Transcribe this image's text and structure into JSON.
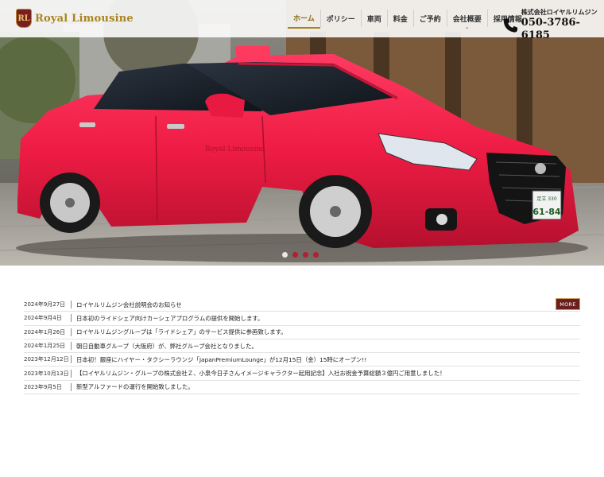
{
  "brand": {
    "logo_mark": "RL",
    "name": "Royal Limousine"
  },
  "nav": {
    "items": [
      {
        "label": "ホーム",
        "active": true
      },
      {
        "label": "ポリシー"
      },
      {
        "label": "車両"
      },
      {
        "label": "料金"
      },
      {
        "label": "ご予約"
      },
      {
        "label": "会社概要",
        "has_dropdown": true
      },
      {
        "label": "採用情報"
      }
    ]
  },
  "contact": {
    "company": "株式会社ロイヤルリムジン",
    "phone": "050-3786-6185"
  },
  "hero": {
    "car_emblem_text": "Royal Limousine",
    "plate_top": "足立 330",
    "plate_number": "61-84",
    "slides": 4,
    "active_slide": 1
  },
  "news": {
    "more_label": "MORE",
    "items": [
      {
        "date": "2024年9月27日",
        "title": "ロイヤルリムジン会社説明会のお知らせ"
      },
      {
        "date": "2024年9月4日",
        "title": "日本初のライドシェア向けカーシェアプログラムの提供を開始します。"
      },
      {
        "date": "2024年1月26日",
        "title": "ロイヤルリムジングループは「ライドシェア」のサービス提供に参画致します。"
      },
      {
        "date": "2024年1月25日",
        "title": "朝日自動車グループ（大阪府）が、弊社グループ会社となりました。"
      },
      {
        "date": "2023年12月12日",
        "title": "日本初！銀座にハイヤー・タクシーラウンジ「JapanPremiumLounge」が12月15日（金）15時にオープン!!"
      },
      {
        "date": "2023年10月13日",
        "title": "【ロイヤルリムジン・グループの株式会社Ｚ、小泉今日子さんイメージキャラクター起用記念】入社お祝金予算総額３億円ご用意しました！"
      },
      {
        "date": "2023年9月5日",
        "title": "新型アルファードの運行を開始致しました。"
      }
    ]
  },
  "colors": {
    "brand_gold": "#a8841f",
    "brand_maroon": "#6b1f1f",
    "car_pink": "#f0224a"
  }
}
